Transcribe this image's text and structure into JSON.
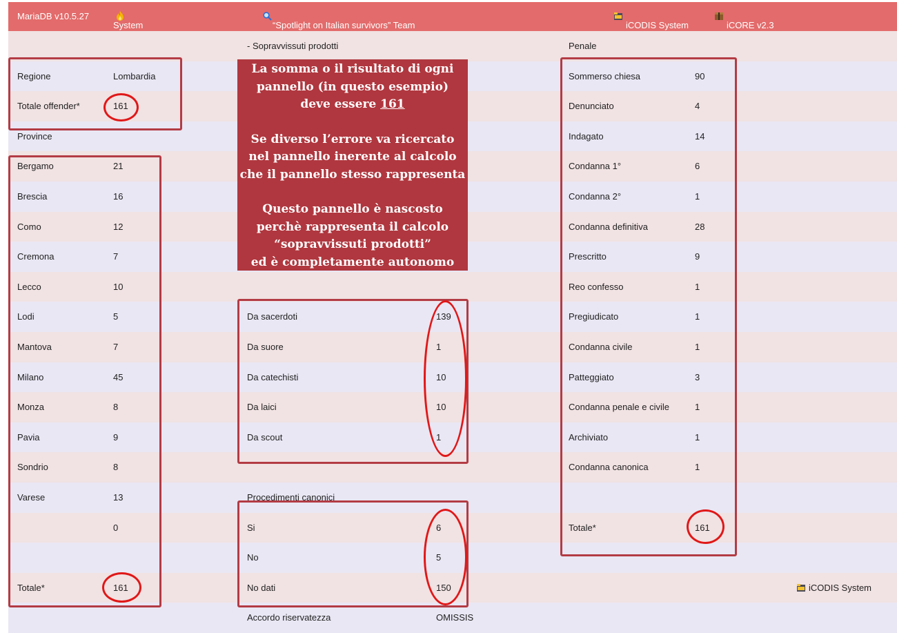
{
  "topbar": {
    "db": "MariaDB v10.5.27",
    "system": "System",
    "team": "“Spotlight on Italian survivors” Team",
    "icodis": "iCODIS System",
    "icore": "iCORE v2.3"
  },
  "left": {
    "regione_label": "Regione",
    "regione_value": "Lombardia",
    "offender_label": "Totale offender*",
    "offender_value": "161",
    "province_label": "Province",
    "rows": [
      {
        "name": "Bergamo",
        "value": "21"
      },
      {
        "name": "Brescia",
        "value": "16"
      },
      {
        "name": "Como",
        "value": "12"
      },
      {
        "name": "Cremona",
        "value": "7"
      },
      {
        "name": "Lecco",
        "value": "10"
      },
      {
        "name": "Lodi",
        "value": "5"
      },
      {
        "name": "Mantova",
        "value": "7"
      },
      {
        "name": "Milano",
        "value": "45"
      },
      {
        "name": "Monza",
        "value": "8"
      },
      {
        "name": "Pavia",
        "value": "9"
      },
      {
        "name": "Sondrio",
        "value": "8"
      },
      {
        "name": "Varese",
        "value": "13"
      },
      {
        "name": "",
        "value": "0"
      }
    ],
    "total_label": "Totale*",
    "total_value": "161"
  },
  "middle": {
    "header": "- Sopravvissuti prodotti",
    "survivors": [
      {
        "name": "Da sacerdoti",
        "value": "139"
      },
      {
        "name": "Da suore",
        "value": "1"
      },
      {
        "name": "Da catechisti",
        "value": "10"
      },
      {
        "name": "Da laici",
        "value": "10"
      },
      {
        "name": "Da scout",
        "value": "1"
      }
    ],
    "canonici_header": "Procedimenti canonici",
    "canonici": [
      {
        "name": "Si",
        "value": "6"
      },
      {
        "name": "No",
        "value": "5"
      },
      {
        "name": "No dati",
        "value": "150"
      }
    ],
    "accordo_label": "Accordo riservatezza",
    "accordo_value": "OMISSIS"
  },
  "note": {
    "line1": "La somma o il risultato di ogni",
    "line2": "pannello (in questo esempio)",
    "line3_prefix": "deve essere ",
    "line3_value": "161",
    "line4": "Se diverso l’errore va ricercato",
    "line5": "nel pannello inerente al calcolo",
    "line6": "che il pannello stesso rappresenta",
    "line7": "Questo pannello è nascosto",
    "line8": "perchè rappresenta il calcolo",
    "line9": "“sopravvissuti prodotti”",
    "line10": "ed è completamente autonomo"
  },
  "right": {
    "header": "Penale",
    "rows": [
      {
        "name": "Sommerso chiesa",
        "value": "90"
      },
      {
        "name": "Denunciato",
        "value": "4"
      },
      {
        "name": "Indagato",
        "value": "14"
      },
      {
        "name": "Condanna 1°",
        "value": "6"
      },
      {
        "name": "Condanna 2°",
        "value": "1"
      },
      {
        "name": "Condanna definitiva",
        "value": "28"
      },
      {
        "name": "Prescritto",
        "value": "9"
      },
      {
        "name": "Reo confesso",
        "value": "1"
      },
      {
        "name": "Pregiudicato",
        "value": "1"
      },
      {
        "name": "Condanna civile",
        "value": "1"
      },
      {
        "name": "Patteggiato",
        "value": "3"
      },
      {
        "name": "Condanna penale e civile",
        "value": "1"
      },
      {
        "name": "Archiviato",
        "value": "1"
      },
      {
        "name": "Condanna canonica",
        "value": "1"
      }
    ],
    "total_label": "Totale*",
    "total_value": "161"
  },
  "footer": {
    "icodis": "iCODIS System"
  },
  "colors": {
    "topbar": "#e36b6b",
    "row_pink": "#f1e2e3",
    "row_lavender": "#e9e7f4",
    "box_border": "#b33b44",
    "oval_red": "#e01818",
    "note_bg": "#b0373f"
  },
  "icons": {
    "system": "fire-icon",
    "team": "magnifier-icon",
    "icodis": "folder-icon",
    "icore": "package-icon"
  }
}
